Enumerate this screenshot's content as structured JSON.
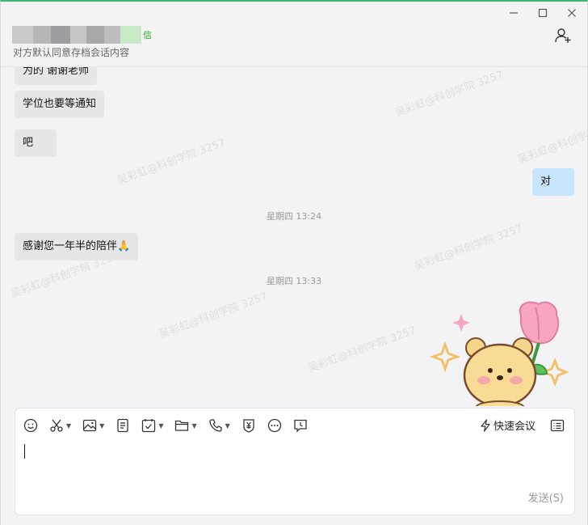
{
  "window": {
    "controls": {
      "minimize": "—",
      "maximize": "☐",
      "close": "✕"
    }
  },
  "header": {
    "chat_name_suffix": "信",
    "subtitle": "对方默认同意存档会话内容"
  },
  "messages": [
    {
      "side": "left",
      "text": "为的 谢谢老师"
    },
    {
      "side": "left",
      "text": "学位也要等通知"
    },
    {
      "side": "left",
      "text": "吧"
    },
    {
      "side": "right",
      "text": "对"
    },
    {
      "type": "time",
      "text": "星期四 13:24"
    },
    {
      "side": "left",
      "text": "感谢您一年半的陪伴🙏"
    },
    {
      "type": "time",
      "text": "星期四 13:33"
    }
  ],
  "watermark_text": "吴彩虹@科创学院 3257",
  "toolbar": {
    "items": [
      "emoji-icon",
      "scissors-icon",
      "image-icon",
      "document-icon",
      "task-icon",
      "folder-icon",
      "phone-icon",
      "payment-icon",
      "more-icon",
      "chat-record-icon"
    ],
    "quick_meeting_label": "快速会议"
  },
  "input": {
    "value": "",
    "send_label": "发送(S)"
  },
  "colors": {
    "accent_green": "#3cb371",
    "bubble_left": "#e6e6e8",
    "bubble_right": "#c8e6fb",
    "background": "#f3f3f5"
  }
}
